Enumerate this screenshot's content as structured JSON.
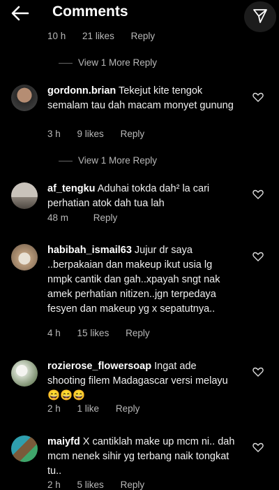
{
  "header": {
    "title": "Comments"
  },
  "top_reply": {
    "time": "10 h",
    "likes": "21 likes",
    "reply": "Reply"
  },
  "view_more": [
    "View 1 More Reply",
    "View 1 More Reply"
  ],
  "comments": [
    {
      "username": "gordonn.brian",
      "text": "Tekejut kite tengok semalam tau dah macam monyet gunung",
      "time": "3 h",
      "likes": "9 likes",
      "reply": "Reply"
    },
    {
      "username": "af_tengku",
      "text": "Aduhai tokda dah² la cari perhatian atok dah tua lah",
      "time": "48 m",
      "likes": "",
      "reply": "Reply"
    },
    {
      "username": "habibah_ismail63",
      "text": "Jujur dr saya ..berpakaian dan makeup ikut usia lg nmpk cantik dan gah..xpayah sngt nak amek perhatian nitizen..jgn terpedaya fesyen dan makeup yg x sepatutnya..",
      "time": "4 h",
      "likes": "15 likes",
      "reply": "Reply"
    },
    {
      "username": "rozierose_flowersoap",
      "text": "Ingat ade shooting filem Madagascar versi melayu😄😄😄",
      "time": "2 h",
      "likes": "1 like",
      "reply": "Reply"
    },
    {
      "username": "maiyfd",
      "text": "X cantiklah make up mcm ni.. dah mcm nenek sihir yg terbang naik tongkat tu..",
      "time": "2 h",
      "likes": "5 likes",
      "reply": "Reply"
    }
  ],
  "colors": {
    "background": "#000000",
    "text": "#f0f0f0",
    "meta": "#b8b8b8"
  }
}
